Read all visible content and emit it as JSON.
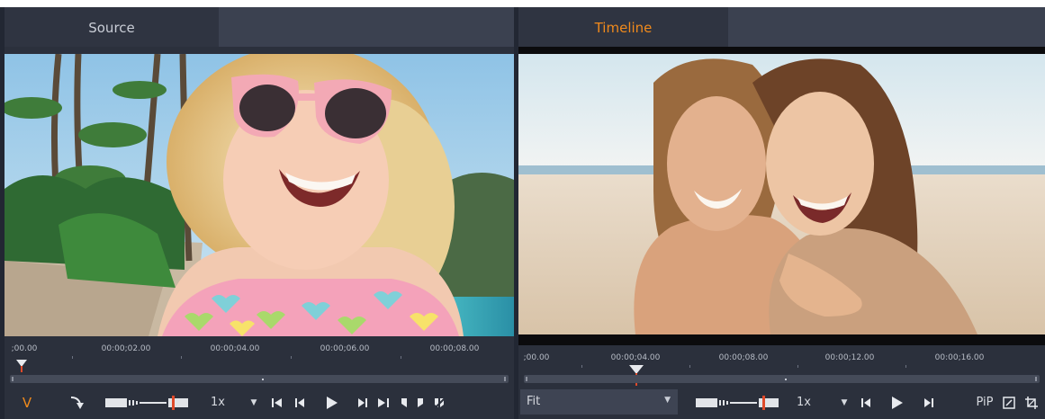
{
  "source_panel": {
    "tab_label": "Source",
    "ruler_labels": [
      ";00.00",
      "00:00;02.00",
      "00:00;04.00",
      "00:00;06.00",
      "00:00;08.00"
    ],
    "mode_label": "V",
    "speed_label": "1x"
  },
  "timeline_panel": {
    "tab_label": "Timeline",
    "ruler_labels": [
      ";00.00",
      "00:00;04.00",
      "00:00;08.00",
      "00:00;12.00",
      "00:00;16.00"
    ],
    "zoom_value": "Fit",
    "speed_label": "1x",
    "pip_label": "PiP"
  },
  "colors": {
    "accent": "#f08a1c",
    "playhead": "#e04a2a",
    "panel": "#2b303c",
    "tab_active": "#2f3441",
    "tab_inactive": "#3b4150"
  },
  "icons": [
    "insert-arrow-icon",
    "shuttle-control-icon",
    "go-to-start-icon",
    "previous-frame-icon",
    "play-icon",
    "next-frame-icon",
    "go-to-end-icon",
    "mark-in-icon",
    "mark-out-icon",
    "clear-marks-icon",
    "fullscreen-icon",
    "crop-icon"
  ]
}
